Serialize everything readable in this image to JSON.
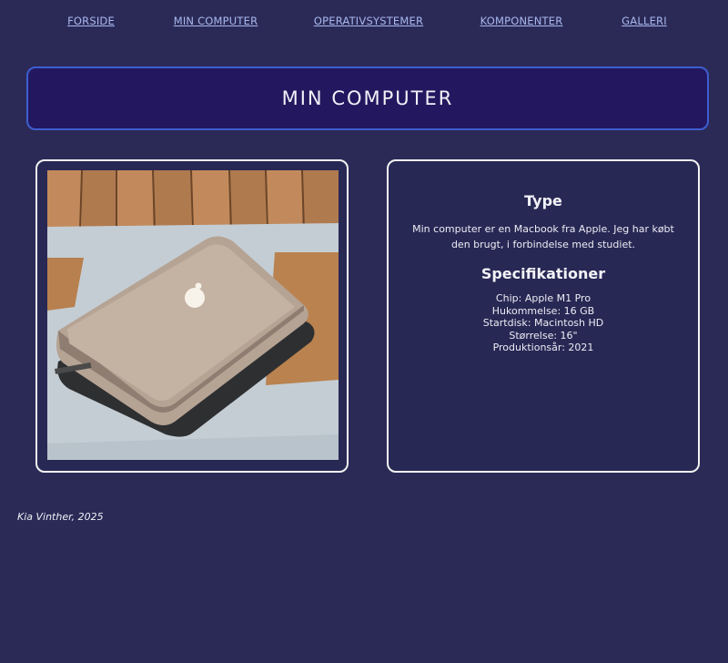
{
  "nav": {
    "items": [
      {
        "label": "FORSIDE"
      },
      {
        "label": "MIN COMPUTER"
      },
      {
        "label": "OPERATIVSYSTEMER"
      },
      {
        "label": "KOMPONENTER"
      },
      {
        "label": "GALLERI"
      }
    ]
  },
  "banner": {
    "title": "MIN COMPUTER"
  },
  "type": {
    "heading": "Type",
    "text": "Min computer er en Macbook fra Apple. Jeg har købt den brugt, i forbindelse med studiet."
  },
  "specs": {
    "heading": "Specifikationer",
    "items": [
      "Chip: Apple M1 Pro",
      "Hukommelse: 16 GB",
      "Startdisk: Macintosh HD",
      "Størrelse: 16\"",
      "Produktionsår: 2021"
    ]
  },
  "footer": {
    "text": "Kia Vinther, 2025"
  },
  "colors": {
    "background": "#2b2a57",
    "nav_link": "#a9b8ee",
    "banner_fill": "#23185f",
    "banner_border": "#3d5ed0",
    "card_border": "#f2f2f2"
  }
}
